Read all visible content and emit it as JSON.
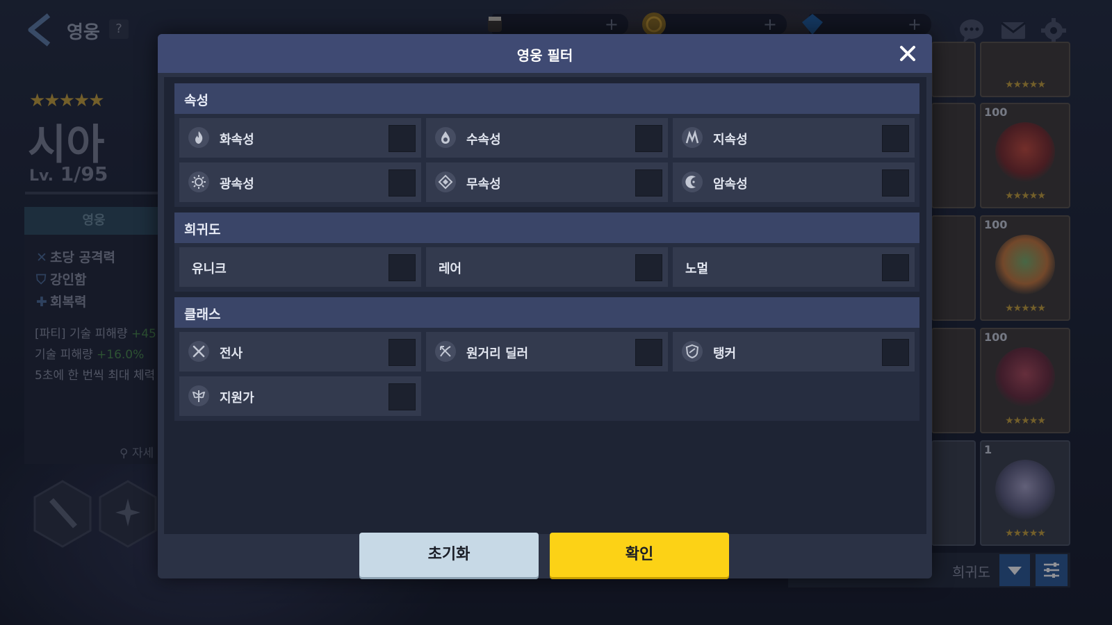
{
  "header": {
    "title": "영웅",
    "help": "?"
  },
  "hero": {
    "stars": "★★★★★",
    "name": "시아",
    "level_prefix": "Lv.",
    "level_value": "1/95",
    "tab": "영웅",
    "stats": [
      "초당 공격력",
      "강인함",
      "회복력"
    ],
    "skill_lines": [
      {
        "text": "[파티] 기술 피해량 ",
        "highlight": "+45"
      },
      {
        "text": "기술 피해량 ",
        "highlight": "+16.0%"
      },
      {
        "text": "5초에 한 번씩 최대 체력",
        "highlight": ""
      }
    ],
    "detail": "자세"
  },
  "cards": [
    {
      "level": "",
      "stars": "★★★★★"
    },
    {
      "level": "100",
      "stars": "★★★★★"
    },
    {
      "level": "100",
      "stars": "★★★★★"
    },
    {
      "level": "100",
      "stars": "★★★★★"
    },
    {
      "level": "1",
      "stars": "★★★★★"
    }
  ],
  "sort": {
    "label": "희귀도"
  },
  "modal": {
    "title": "영웅 필터",
    "sections": {
      "attribute": {
        "title": "속성",
        "options": [
          {
            "label": "화속성",
            "icon": "fire-icon"
          },
          {
            "label": "수속성",
            "icon": "water-icon"
          },
          {
            "label": "지속성",
            "icon": "earth-icon"
          },
          {
            "label": "광속성",
            "icon": "light-icon"
          },
          {
            "label": "무속성",
            "icon": "basic-icon"
          },
          {
            "label": "암속성",
            "icon": "dark-icon"
          }
        ]
      },
      "rarity": {
        "title": "희귀도",
        "options": [
          {
            "label": "유니크"
          },
          {
            "label": "레어"
          },
          {
            "label": "노멀"
          }
        ]
      },
      "class": {
        "title": "클래스",
        "options": [
          {
            "label": "전사",
            "icon": "warrior-icon"
          },
          {
            "label": "원거리 딜러",
            "icon": "ranged-icon"
          },
          {
            "label": "탱커",
            "icon": "tanker-icon"
          },
          {
            "label": "지원가",
            "icon": "support-icon"
          }
        ]
      }
    },
    "reset_label": "초기화",
    "confirm_label": "확인"
  }
}
